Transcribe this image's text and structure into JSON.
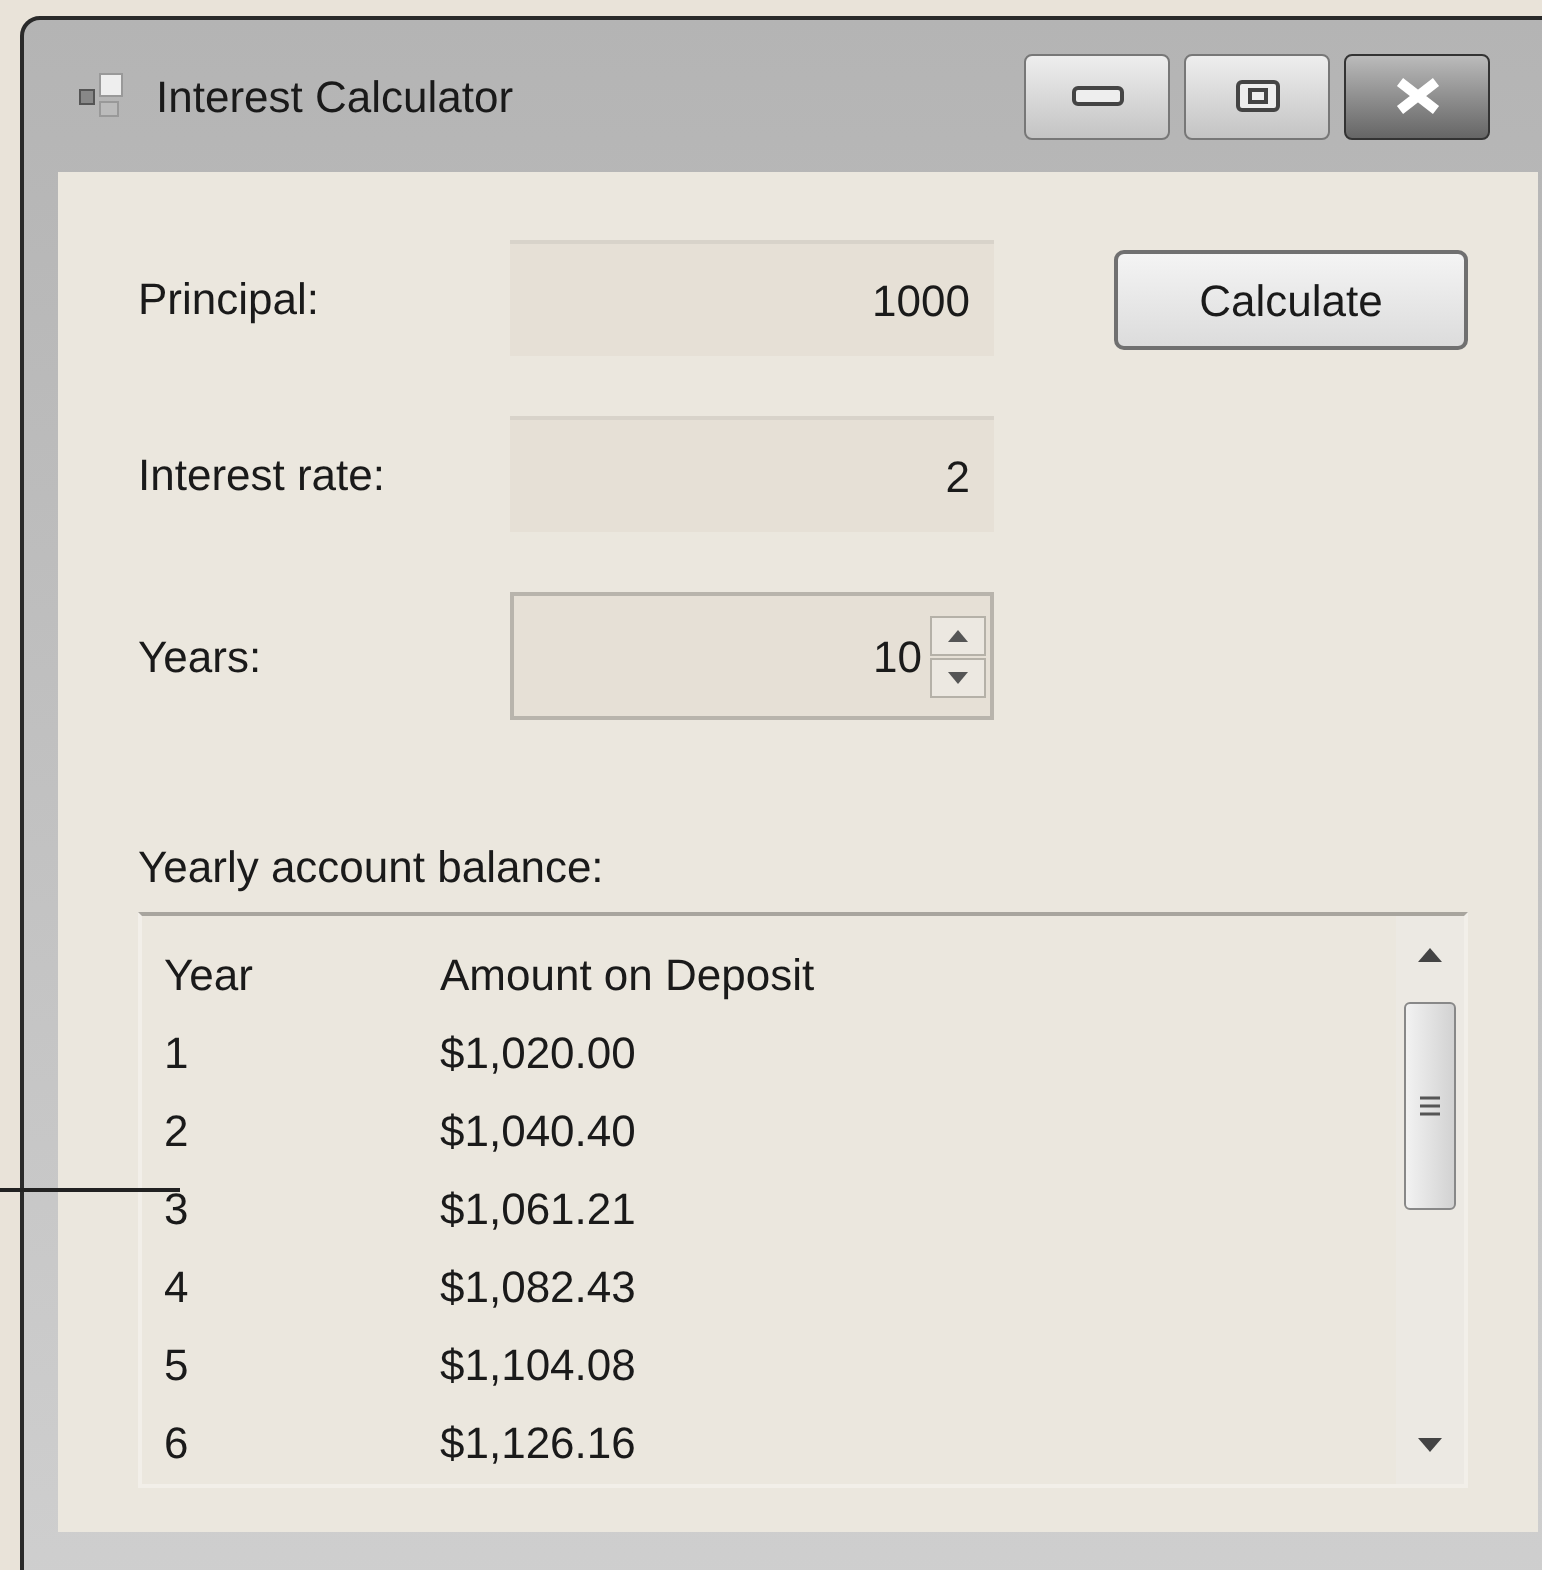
{
  "window": {
    "title": "Interest Calculator"
  },
  "fields": [
    {
      "label": "Principal:",
      "value": "1000",
      "kind": "text"
    },
    {
      "label": "Interest rate:",
      "value": "2",
      "kind": "text"
    },
    {
      "label": "Years:",
      "value": "10",
      "kind": "spinner"
    }
  ],
  "calculate_button": "Calculate",
  "balance_label": "Yearly account balance:",
  "list": {
    "header": [
      "Year",
      "Amount on Deposit"
    ],
    "rows": [
      [
        "1",
        "$1,020.00"
      ],
      [
        "2",
        "$1,040.40"
      ],
      [
        "3",
        "$1,061.21"
      ],
      [
        "4",
        "$1,082.43"
      ],
      [
        "5",
        "$1,104.08"
      ],
      [
        "6",
        "$1,126.16"
      ]
    ]
  }
}
